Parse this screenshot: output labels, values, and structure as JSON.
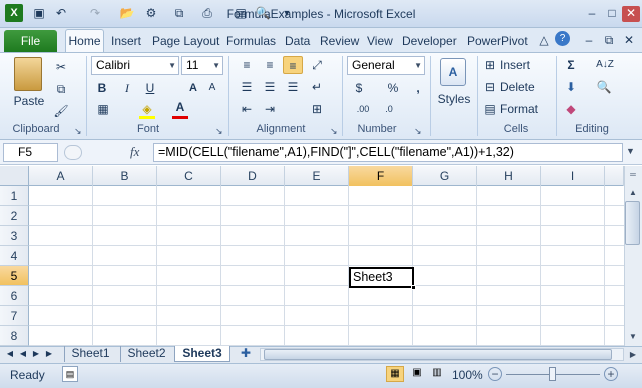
{
  "window": {
    "title": "FormulaExamples  -  Microsoft Excel",
    "min": "–",
    "max": "□",
    "close": "✕"
  },
  "ribbon_tabs": [
    "File",
    "Home",
    "Insert",
    "Page Layout",
    "Formulas",
    "Data",
    "Review",
    "View",
    "Developer",
    "PowerPivot"
  ],
  "groups": {
    "clipboard": "Clipboard",
    "font": "Font",
    "alignment": "Alignment",
    "number": "Number",
    "styles": "Styles",
    "cells": "Cells",
    "editing": "Editing"
  },
  "clipboard": {
    "paste": "Paste"
  },
  "font": {
    "name": "Calibri",
    "size": "11",
    "bold": "B",
    "italic": "I",
    "underline": "U"
  },
  "number": {
    "format": "General",
    "currency": "$",
    "percent": "%",
    "comma": ","
  },
  "cells": {
    "insert": "Insert",
    "delete": "Delete",
    "format": "Format"
  },
  "formula_bar": {
    "name_box": "F5",
    "fx": "fx",
    "formula": "=MID(CELL(\"filename\",A1),FIND(\"]\",CELL(\"filename\",A1))+1,32)"
  },
  "columns": [
    "A",
    "B",
    "C",
    "D",
    "E",
    "F",
    "G",
    "H",
    "I"
  ],
  "rows": [
    "1",
    "2",
    "3",
    "4",
    "5",
    "6",
    "7",
    "8"
  ],
  "active_cell": {
    "ref": "F5",
    "value": "Sheet3"
  },
  "sheets": [
    "Sheet1",
    "Sheet2",
    "Sheet3"
  ],
  "active_sheet": "Sheet3",
  "status": {
    "mode": "Ready",
    "zoom": "100%"
  },
  "colors": {
    "accent": "#1e7a1f",
    "selection": "#f1c15f"
  }
}
